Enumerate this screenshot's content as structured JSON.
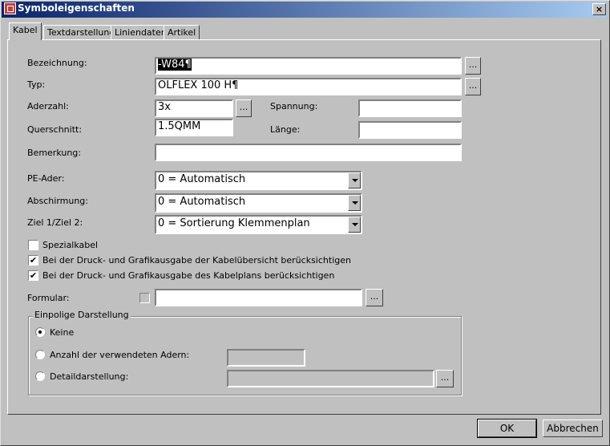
{
  "window": {
    "title": "Symboleigenschaften",
    "close_label": "×"
  },
  "tabs": [
    {
      "label": "Kabel",
      "active": true
    },
    {
      "label": "Textdarstellung",
      "active": false
    },
    {
      "label": "Liniendaten",
      "active": false
    },
    {
      "label": "Artikel",
      "active": false
    }
  ],
  "form": {
    "bezeichnung": {
      "label": "Bezeichnung:",
      "value": "-W84¶",
      "browse": "..."
    },
    "typ": {
      "label": "Typ:",
      "value": "ÖLFLEX 100 H¶",
      "browse": "..."
    },
    "aderzahl": {
      "label": "Aderzahl:",
      "value": "3x",
      "browse": "..."
    },
    "spannung": {
      "label": "Spannung:",
      "value": ""
    },
    "querschnitt": {
      "label": "Querschnitt:",
      "value": "1.5QMM"
    },
    "laenge": {
      "label": "Länge:",
      "value": ""
    },
    "bemerkung": {
      "label": "Bemerkung:",
      "value": ""
    },
    "pe_ader": {
      "label": "PE-Ader:",
      "value": "0 = Automatisch"
    },
    "abschirmung": {
      "label": "Abschirmung:",
      "value": "0 = Automatisch"
    },
    "ziel": {
      "label": "Ziel 1/Ziel 2:",
      "value": "0 = Sortierung Klemmenplan"
    },
    "spezialkabel": {
      "label": "Spezialkabel",
      "checked": false
    },
    "kabeluebersicht": {
      "label": "Bei der Druck- und Grafikausgabe der Kabelübersicht berücksichtigen",
      "checked": true
    },
    "kabelplans": {
      "label": "Bei der Druck- und Grafikausgabe des Kabelplans berücksichtigen",
      "checked": true
    },
    "formular": {
      "label": "Formular:",
      "checked": false,
      "value": "",
      "browse": "..."
    }
  },
  "einpolige": {
    "title": "Einpolige Darstellung",
    "options": [
      {
        "label": "Keine",
        "selected": true
      },
      {
        "label": "Anzahl der verwendeten Adern:",
        "selected": false
      },
      {
        "label": "Detaildarstellung:",
        "selected": false
      }
    ],
    "detail_browse": "..."
  },
  "buttons": {
    "ok": "OK",
    "cancel": "Abbrechen"
  },
  "check_glyph": "✔"
}
